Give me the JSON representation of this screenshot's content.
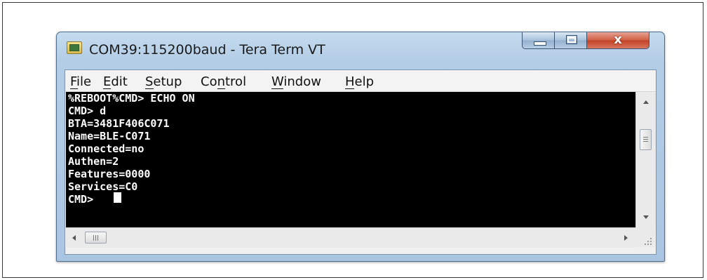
{
  "window": {
    "title": "COM39:115200baud - Tera Term VT",
    "close_label": "x"
  },
  "menu": [
    {
      "label": "File"
    },
    {
      "label": "Edit"
    },
    {
      "label": "Setup"
    },
    {
      "label": "Control"
    },
    {
      "label": "Window"
    },
    {
      "label": "Help"
    }
  ],
  "terminal": {
    "lines": [
      "%REBOOT%CMD> ECHO ON",
      "CMD> d",
      "BTA=3481F406C071",
      "Name=BLE-C071",
      "Connected=no",
      "Authen=2",
      "Features=0000",
      "Services=C0",
      "CMD> "
    ]
  },
  "icons": {
    "app": "tera-term-icon",
    "minimize": "minimize-icon",
    "maximize": "maximize-icon",
    "close": "close-icon"
  },
  "colors": {
    "terminal_bg": "#000000",
    "terminal_fg": "#ffffff",
    "close_button": "#c7462b",
    "title_bar": "#b3cde6"
  }
}
